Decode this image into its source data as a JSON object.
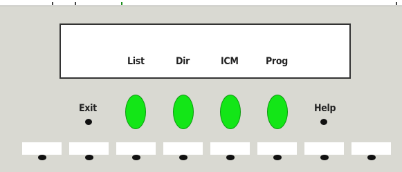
{
  "display": {
    "softkeys": [
      {
        "label": "List",
        "state": "green"
      },
      {
        "label": "Dir",
        "state": "green"
      },
      {
        "label": "ICM",
        "state": "green"
      },
      {
        "label": "Prog",
        "state": "green"
      }
    ]
  },
  "buttons": {
    "exit_label": "Exit",
    "help_label": "Help"
  },
  "colors": {
    "panel": "#d9d9d2",
    "screen": "#ffffff",
    "active_softkey": "#13e617",
    "indicator": "#111111"
  }
}
